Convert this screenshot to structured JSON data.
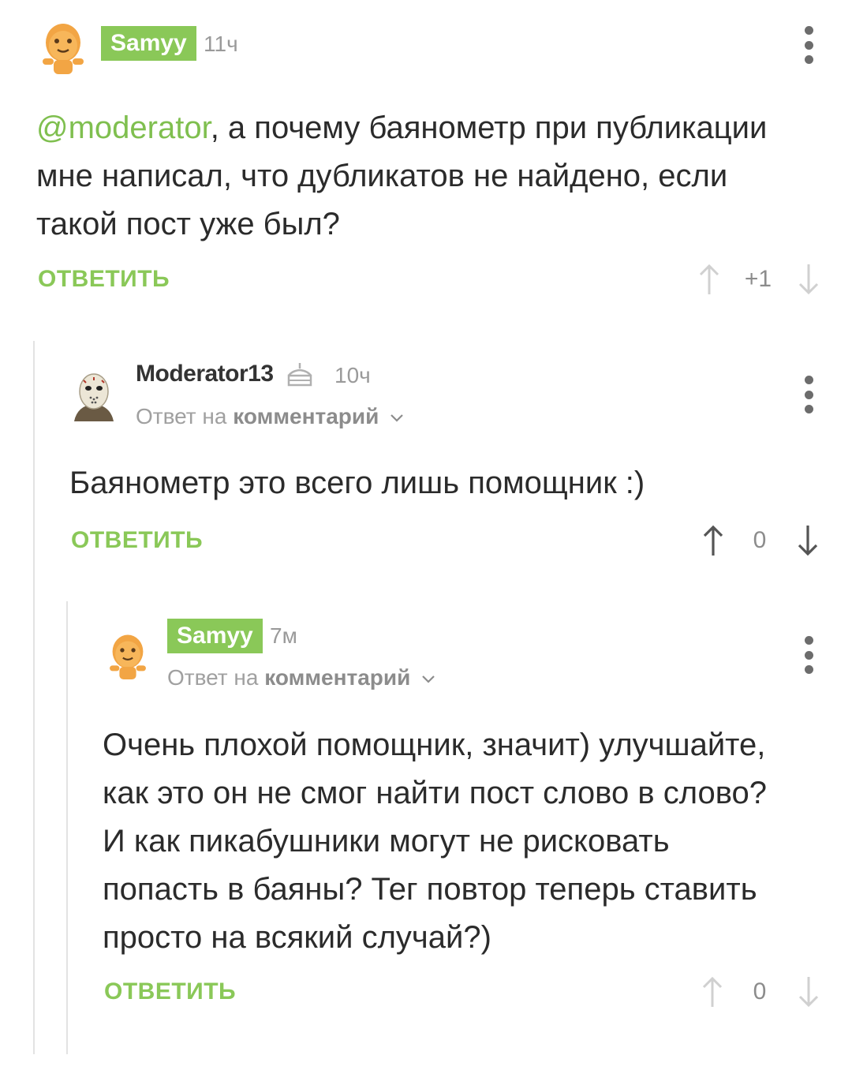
{
  "comments": [
    {
      "author": "Samyy",
      "time": "11ч",
      "mention": "@moderator",
      "text_line1_rest": ", а почему баянометр при публикации",
      "text_line2": "мне написал, что дубликатов не найдено, если",
      "text_line3": "такой пост уже был?",
      "reply_label": "ОТВЕТИТЬ",
      "rating": "+1",
      "avatar_icon": "gingerbread-avatar-icon"
    },
    {
      "author": "Moderator13",
      "moderator_icon": "cake-moderator-icon",
      "time": "10ч",
      "reply_prefix": "Ответ на",
      "reply_target": "комментарий",
      "text": "Баянометр это всего лишь помощник :)",
      "reply_label": "ОТВЕТИТЬ",
      "rating": "0",
      "avatar_icon": "hockey-mask-avatar-icon"
    },
    {
      "author": "Samyy",
      "time": "7м",
      "reply_prefix": "Ответ на",
      "reply_target": "комментарий",
      "lines": [
        "Очень плохой помощник, значит) улучшайте,",
        "как это он не смог найти пост слово в слово?",
        "И как пикабушники могут не рисковать",
        "попасть в баяны? Тег повтор теперь ставить",
        "просто на всякий случай?)"
      ],
      "reply_label": "ОТВЕТИТЬ",
      "rating": "0",
      "avatar_icon": "gingerbread-avatar-icon"
    }
  ],
  "colors": {
    "accent": "#8ac858",
    "mention": "#7fbf4f",
    "muted": "#9a9a9a"
  }
}
